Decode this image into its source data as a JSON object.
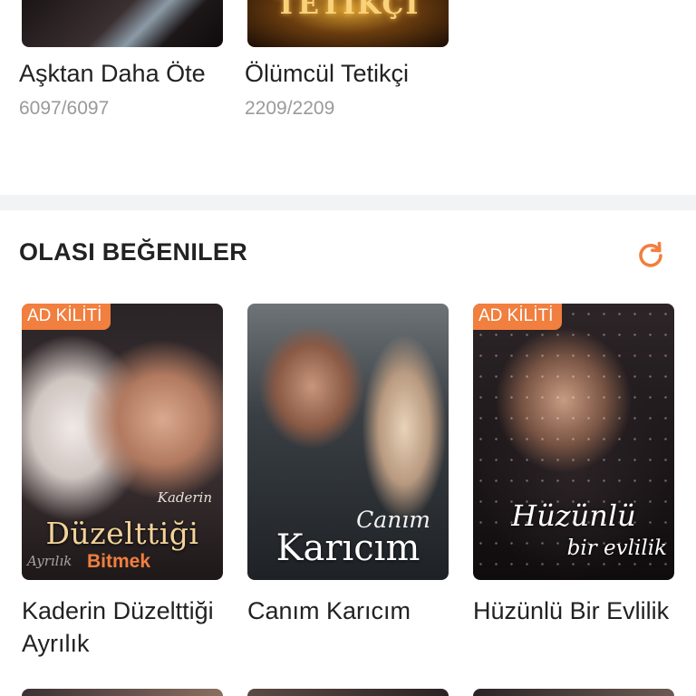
{
  "continue_reading": {
    "items": [
      {
        "title": "Aşktan Daha Öte",
        "progress": "6097/6097"
      },
      {
        "title": "Ölümcül Tetikçi",
        "progress": "2209/2209",
        "cover_text": "TETİKÇİ"
      }
    ]
  },
  "recommendations": {
    "heading": "OLASI BEĞENILER",
    "refresh_icon": "refresh-icon",
    "accent_color": "#f17f3f",
    "books": [
      {
        "title": "Kaderin Düzelttiği Ayrılık",
        "badge": "AD KİLİTİ",
        "cover_title": "Düzelttiği",
        "cover_subtitle": "Kaderin",
        "cover_ghost": "Ayrılık",
        "cover_tag": "Bitmek"
      },
      {
        "title": "Canım Karıcım",
        "badge": "",
        "cover_subtitle": "Canım",
        "cover_title": "Karıcım"
      },
      {
        "title": "Hüzünlü Bir Evlilik",
        "badge": "AD KİLİTİ",
        "cover_title": "Hüzünlü",
        "cover_subtitle": "bir evlilik"
      }
    ]
  }
}
